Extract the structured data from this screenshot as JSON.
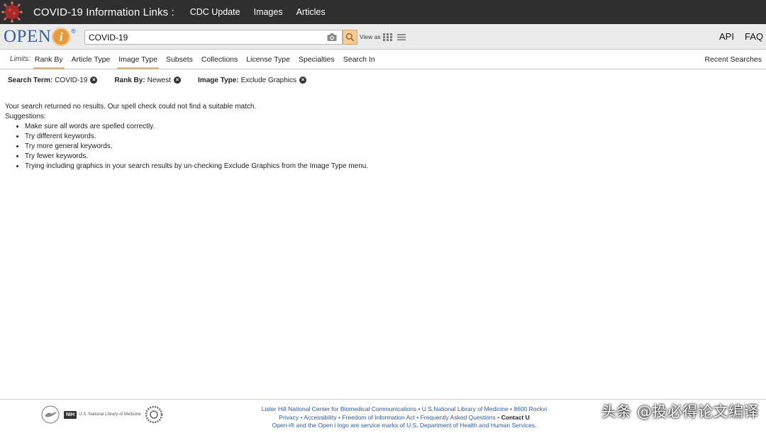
{
  "banner": {
    "title": "COVID-19 Information Links :",
    "links": [
      "CDC Update",
      "Images",
      "Articles"
    ],
    "icon": "coronavirus-icon"
  },
  "brand": {
    "logo_text": "OPEN",
    "logo_i": "i",
    "logo_reg": "®"
  },
  "search": {
    "value": "COVID-19",
    "view_as": "View as"
  },
  "nav_right": {
    "api": "API",
    "faq": "FAQ"
  },
  "limits": {
    "label": "Limits:",
    "items": [
      "Rank By",
      "Article Type",
      "Image Type",
      "Subsets",
      "Collections",
      "License Type",
      "Specialties",
      "Search In"
    ],
    "active": [
      "Rank By",
      "Image Type"
    ],
    "recent": "Recent Searches"
  },
  "filters": [
    {
      "key": "Search Term:",
      "value": "COVID-19"
    },
    {
      "key": "Rank By:",
      "value": "Newest"
    },
    {
      "key": "Image Type:",
      "value": "Exclude Graphics"
    }
  ],
  "results": {
    "message": "Your search returned no results. Our spell check could not find a suitable match.",
    "suggestions_label": "Suggestions:",
    "suggestions": [
      "Make sure all words are spelled correctly.",
      "Try different keywords.",
      "Try more general keywords.",
      "Try fewer keywords.",
      "Trying including graphics in your search results by un-checking Exclude Graphics from the Image Type menu."
    ]
  },
  "footer": {
    "nih": "NIH",
    "nlm": "U.S. National Library of Medicine",
    "line1": "Lister Hill National Center for Biomedical Communications • U.S.National Library of Medicine • 8600 Rockvi",
    "line2_links": [
      "Privacy",
      "Accessibility",
      "Freedom of Information Act",
      "Frequently Asked Questions"
    ],
    "line2_contact": "Contact U",
    "line3": "Open-i® and the Open i logo are service marks of U.S. Department of Health and Human Services."
  },
  "watermark": "头条 @投必得论文编译",
  "colors": {
    "banner_bg": "#2f2f2f",
    "logo_blue": "#3a5f9e",
    "logo_orange": "#e59a3b",
    "tab_underline": "#e3b27a",
    "footer_link": "#2b5aa0"
  }
}
